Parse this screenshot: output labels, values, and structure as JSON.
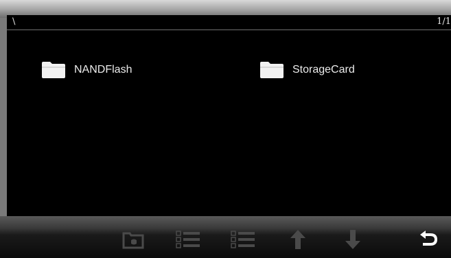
{
  "header": {
    "path": "\\",
    "page_indicator": "1/1"
  },
  "files": [
    {
      "name": "NANDFlash",
      "icon": "folder-icon"
    },
    {
      "name": "StorageCard",
      "icon": "folder-icon"
    }
  ],
  "toolbar": {
    "buttons": [
      {
        "icon": "folder-open-icon",
        "enabled": false
      },
      {
        "icon": "check-list-icon",
        "enabled": false
      },
      {
        "icon": "uncheck-list-icon",
        "enabled": false
      },
      {
        "icon": "arrow-up-icon",
        "enabled": false
      },
      {
        "icon": "arrow-down-icon",
        "enabled": false
      },
      {
        "icon": "back-icon",
        "enabled": true
      }
    ]
  },
  "colors": {
    "background": "#000000",
    "text": "#ececec",
    "disabled_icon": "#4a4a4a",
    "enabled_icon": "#ffffff"
  }
}
